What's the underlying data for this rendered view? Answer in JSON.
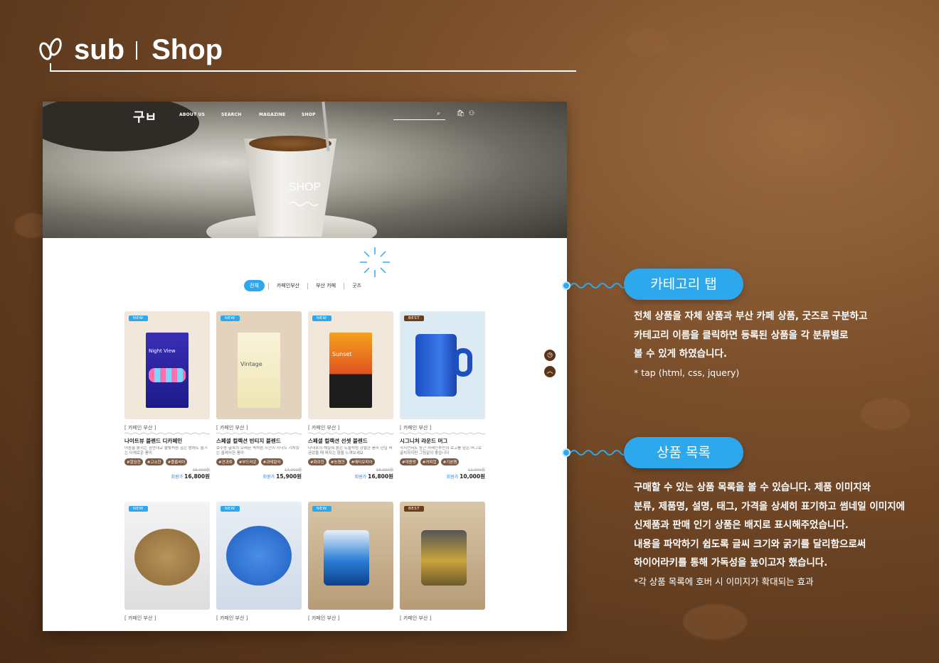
{
  "header": {
    "sub": "sub",
    "shop": "Shop"
  },
  "site": {
    "nav": {
      "logo": "구ㅂ",
      "items": [
        "ABOUT US",
        "SEARCH",
        "MAGAZINE",
        "SHOP"
      ]
    },
    "hero_title": "SHOP",
    "tabs": [
      "전체",
      "카페인부산",
      "부산 카페",
      "굿즈"
    ],
    "products": [
      {
        "badge": "NEW",
        "category": "[ 카페인 부산 ]",
        "name": "나이트뷰 블렌드 디카페인",
        "desc": "어둠을 밝히는 광안대교 불빛처럼 깊은 밤에도 즐기는 다채로운 풍미",
        "tags": [
          "#깔끔한",
          "#고소한",
          "#플롭비아"
        ],
        "old_price": "18,000원",
        "member": "회원가",
        "price": "16,800원",
        "bag_label": "Night View"
      },
      {
        "badge": "NEW",
        "category": "[ 카페인 부산 ]",
        "name": "스페셜 컬렉션 빈티지 블렌드",
        "desc": "보수동 골목의 오래된 책처럼 시간이 지나도 가치있는 클래식한 풍미",
        "tags": [
          "#견과류",
          "#부드러운",
          "#과테말라"
        ],
        "old_price": "17,000원",
        "member": "회원가",
        "price": "15,900원",
        "bag_label": "Vintage"
      },
      {
        "badge": "NEW",
        "category": "[ 카페인 부산 ]",
        "name": "스페셜 컬렉션 선셋 블렌드",
        "desc": "다대포의 해질녘 붉은 노을처럼 강렬한 풍미 한입 머금었을 때 퍼지는 향을 느껴보세요",
        "tags": [
          "#화려한",
          "#농염한",
          "#에티오피아"
        ],
        "old_price": "18,000원",
        "member": "회원가",
        "price": "16,800원",
        "bag_label": "Sunset"
      },
      {
        "badge": "BEST",
        "category": "[ 카페인 부산 ]",
        "name": "시그니처 라운드 머그",
        "desc": "각지언서도 둥근 카페인부산의 로고를 담은 머그로 골치하지만 그림같이 좋습니다",
        "tags": [
          "#대용량",
          "#커피컵",
          "#기본템"
        ],
        "old_price": "12,000원",
        "member": "회원가",
        "price": "10,000원",
        "bag_label": ""
      },
      {
        "badge": "NEW",
        "category": "[ 카페인 부산 ]"
      },
      {
        "badge": "NEW",
        "category": "[ 카페인 부산 ]"
      },
      {
        "badge": "NEW",
        "category": "[ 카페인 부산 ]"
      },
      {
        "badge": "BEST",
        "category": "[ 카페인 부산 ]"
      }
    ],
    "side_buttons": [
      "◷",
      "︿"
    ]
  },
  "annotations": [
    {
      "pill": "카테고리 탭",
      "lines": [
        "전체 상품을 자체 상품과 부산 카페 상품, 굿즈로 구분하고",
        "카테고리 이름을 클릭하면 등록된 상품을 각 분류별로",
        "볼 수 있게 하였습니다."
      ],
      "note": "* tap (html, css, jquery)"
    },
    {
      "pill": "상품 목록",
      "lines": [
        "구매할 수 있는 상품 목록을 볼 수 있습니다. 제품 이미지와",
        "분류, 제품명, 설명, 태그, 가격을 상세히 표기하고 썸네일 이미지에",
        "신제품과 판매 인기 상품은 배지로 표시해주었습니다.",
        "내용을 파악하기 쉽도록 글씨 크기와 굵기를 달리함으로써",
        "하이어라키를 통해 가독성을 높이고자 했습니다."
      ],
      "note": "*각 상품 목록에 호버 시 이미지가 확대되는 효과"
    }
  ],
  "colors": {
    "accent": "#2ea8ec",
    "brown": "#6b3e1a"
  }
}
